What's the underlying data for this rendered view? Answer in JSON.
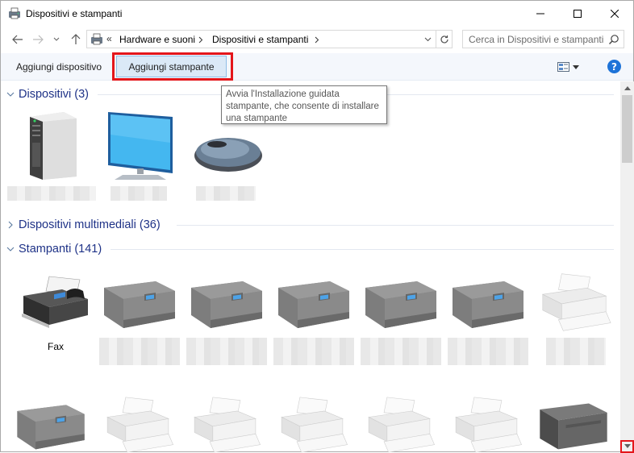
{
  "window": {
    "title": "Dispositivi e stampanti"
  },
  "nav": {
    "breadcrumb_overflow": "«",
    "breadcrumb": [
      "Hardware e suoni",
      "Dispositivi e stampanti"
    ],
    "search_placeholder": "Cerca in Dispositivi e stampanti"
  },
  "toolbar": {
    "add_device": "Aggiungi dispositivo",
    "add_printer": "Aggiungi stampante",
    "help": "?"
  },
  "tooltip": {
    "lines": [
      "Avvia l'Installazione guidata",
      "stampante, che consente di installare",
      "una stampante"
    ]
  },
  "groups": {
    "devices": {
      "title": "Dispositivi (3)",
      "expanded": true,
      "items": [
        {
          "icon": "desktop-tower-icon"
        },
        {
          "icon": "monitor-icon"
        },
        {
          "icon": "mouse-icon"
        }
      ]
    },
    "multimedia": {
      "title": "Dispositivi multimediali (36)",
      "expanded": false
    },
    "printers": {
      "title": "Stampanti (141)",
      "expanded": true,
      "items": [
        {
          "icon": "fax-icon",
          "label": "Fax"
        },
        {
          "icon": "printer-icon"
        },
        {
          "icon": "printer-icon"
        },
        {
          "icon": "printer-icon"
        },
        {
          "icon": "printer-icon"
        },
        {
          "icon": "printer-icon"
        },
        {
          "icon": "printer-icon"
        }
      ]
    }
  },
  "colors": {
    "accent_blue": "#1e3287",
    "highlight_red": "#e4161b",
    "selected_button": "#dbe9f7"
  }
}
